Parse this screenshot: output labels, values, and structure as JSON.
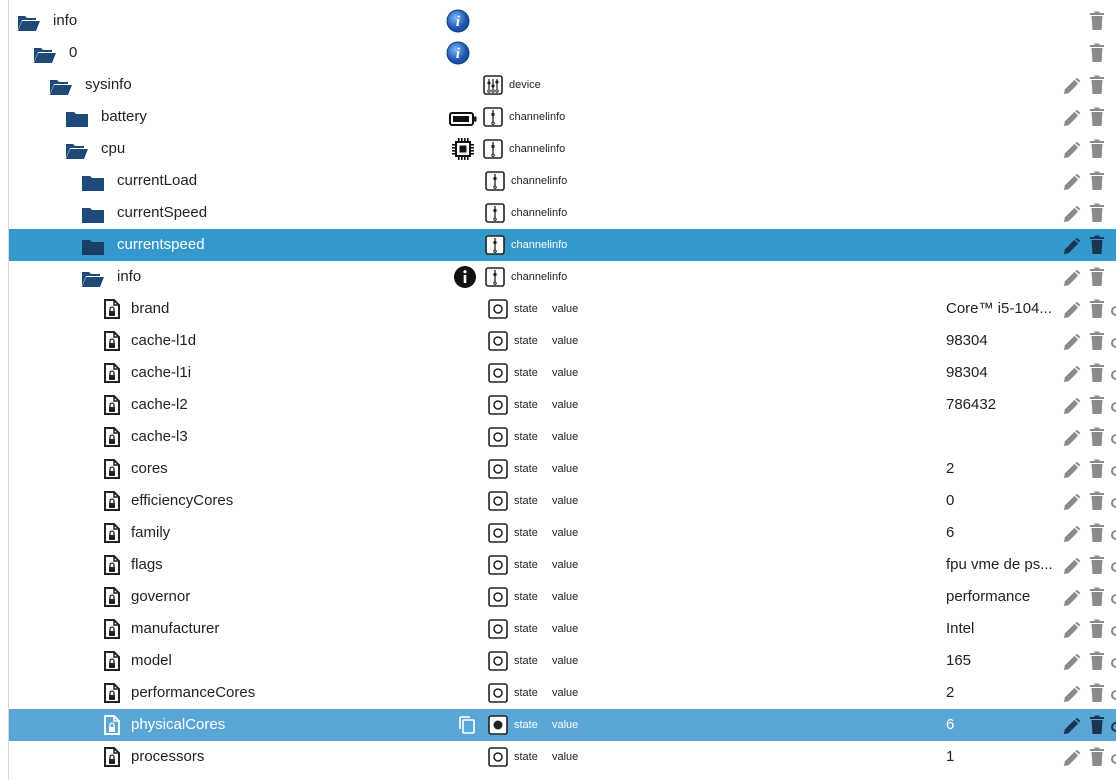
{
  "colors": {
    "folder": "#1e4a7a",
    "selected_dark": "#3399cc",
    "selected_light": "#5aa6d6",
    "action_gray": "#8a8a8a"
  },
  "rows": [
    {
      "name": "info",
      "depth": 0,
      "icon": "folder-open-icon",
      "badge": "info-blue-icon"
    },
    {
      "name": "0",
      "depth": 1,
      "icon": "folder-open-icon",
      "badge": "info-blue-icon"
    },
    {
      "name": "sysinfo",
      "depth": 2,
      "icon": "folder-open-icon",
      "type_icon": "device-icon",
      "role": "device"
    },
    {
      "name": "battery",
      "depth": 3,
      "icon": "folder-closed-icon",
      "mid_icon": "battery-icon",
      "type_icon": "channel-icon",
      "role": "channelinfo"
    },
    {
      "name": "cpu",
      "depth": 3,
      "icon": "folder-open-icon",
      "mid_icon": "cpu-chip-icon",
      "type_icon": "channel-icon",
      "role": "channelinfo"
    },
    {
      "name": "currentLoad",
      "depth": 4,
      "icon": "folder-closed-icon",
      "type_icon": "channel-icon",
      "role": "channelinfo"
    },
    {
      "name": "currentSpeed",
      "depth": 4,
      "icon": "folder-closed-icon",
      "type_icon": "channel-icon",
      "role": "channelinfo"
    },
    {
      "name": "currentspeed",
      "depth": 4,
      "icon": "folder-closed-icon",
      "type_icon": "channel-icon",
      "role": "channelinfo",
      "selected": "dark"
    },
    {
      "name": "info",
      "depth": 4,
      "icon": "folder-open-icon",
      "mid_icon": "info-black-icon",
      "type_icon": "channel-icon",
      "role": "channelinfo"
    },
    {
      "name": "brand",
      "depth": 5,
      "icon": "file-lock-icon",
      "type_icon": "state-icon",
      "state": "state",
      "role": "value",
      "value": "Core™ i5-104..."
    },
    {
      "name": "cache-l1d",
      "depth": 5,
      "icon": "file-lock-icon",
      "type_icon": "state-icon",
      "state": "state",
      "role": "value",
      "value": "98304"
    },
    {
      "name": "cache-l1i",
      "depth": 5,
      "icon": "file-lock-icon",
      "type_icon": "state-icon",
      "state": "state",
      "role": "value",
      "value": "98304"
    },
    {
      "name": "cache-l2",
      "depth": 5,
      "icon": "file-lock-icon",
      "type_icon": "state-icon",
      "state": "state",
      "role": "value",
      "value": "786432"
    },
    {
      "name": "cache-l3",
      "depth": 5,
      "icon": "file-lock-icon",
      "type_icon": "state-icon",
      "state": "state",
      "role": "value",
      "value": ""
    },
    {
      "name": "cores",
      "depth": 5,
      "icon": "file-lock-icon",
      "type_icon": "state-icon",
      "state": "state",
      "role": "value",
      "value": "2"
    },
    {
      "name": "efficiencyCores",
      "depth": 5,
      "icon": "file-lock-icon",
      "type_icon": "state-icon",
      "state": "state",
      "role": "value",
      "value": "0"
    },
    {
      "name": "family",
      "depth": 5,
      "icon": "file-lock-icon",
      "type_icon": "state-icon",
      "state": "state",
      "role": "value",
      "value": "6"
    },
    {
      "name": "flags",
      "depth": 5,
      "icon": "file-lock-icon",
      "type_icon": "state-icon",
      "state": "state",
      "role": "value",
      "value": "fpu vme de ps..."
    },
    {
      "name": "governor",
      "depth": 5,
      "icon": "file-lock-icon",
      "type_icon": "state-icon",
      "state": "state",
      "role": "value",
      "value": "performance"
    },
    {
      "name": "manufacturer",
      "depth": 5,
      "icon": "file-lock-icon",
      "type_icon": "state-icon",
      "state": "state",
      "role": "value",
      "value": "Intel"
    },
    {
      "name": "model",
      "depth": 5,
      "icon": "file-lock-icon",
      "type_icon": "state-icon",
      "state": "state",
      "role": "value",
      "value": "165"
    },
    {
      "name": "performanceCores",
      "depth": 5,
      "icon": "file-lock-icon",
      "type_icon": "state-icon",
      "state": "state",
      "role": "value",
      "value": "2"
    },
    {
      "name": "physicalCores",
      "depth": 5,
      "icon": "file-lock-icon",
      "mid_icon": "copy-icon",
      "type_icon": "state-icon",
      "state": "state",
      "role": "value",
      "value": "6",
      "selected": "light"
    },
    {
      "name": "processors",
      "depth": 5,
      "icon": "file-lock-icon",
      "type_icon": "state-icon",
      "state": "state",
      "role": "value",
      "value": "1"
    }
  ]
}
